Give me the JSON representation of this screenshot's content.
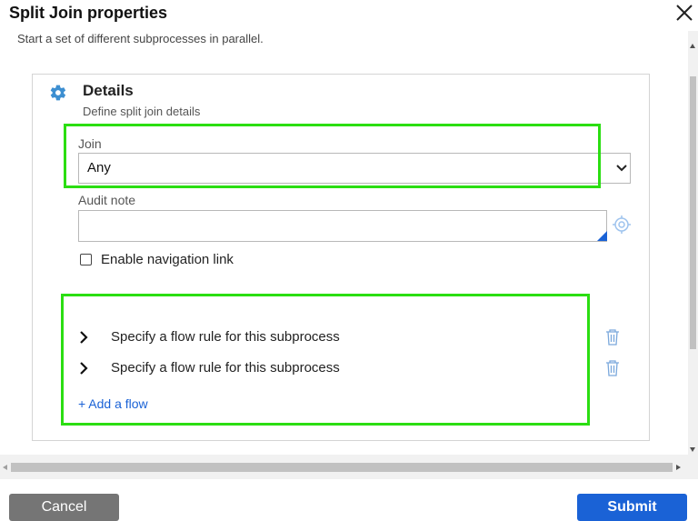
{
  "dialog": {
    "title": "Split Join properties",
    "subtitle": "Start a set of different subprocesses in parallel."
  },
  "details": {
    "title": "Details",
    "subtitle": "Define split join details"
  },
  "join": {
    "label": "Join",
    "value": "Any"
  },
  "audit": {
    "label": "Audit note",
    "value": ""
  },
  "navigation": {
    "label": "Enable navigation link",
    "checked": false
  },
  "flows": [
    {
      "label": "Specify a flow rule for this subprocess"
    },
    {
      "label": "Specify a flow rule for this subprocess"
    }
  ],
  "add_flow": "+ Add a flow",
  "buttons": {
    "cancel": "Cancel",
    "submit": "Submit"
  },
  "icons": {
    "close": "close-icon",
    "gear": "gear-icon",
    "chevron": "chevron-down-icon",
    "target": "target-icon",
    "expand": "chevron-right-icon",
    "trash": "trash-icon"
  },
  "colors": {
    "accent": "#1a62d6",
    "highlight": "#2bde12",
    "cancel_bg": "#757575"
  }
}
